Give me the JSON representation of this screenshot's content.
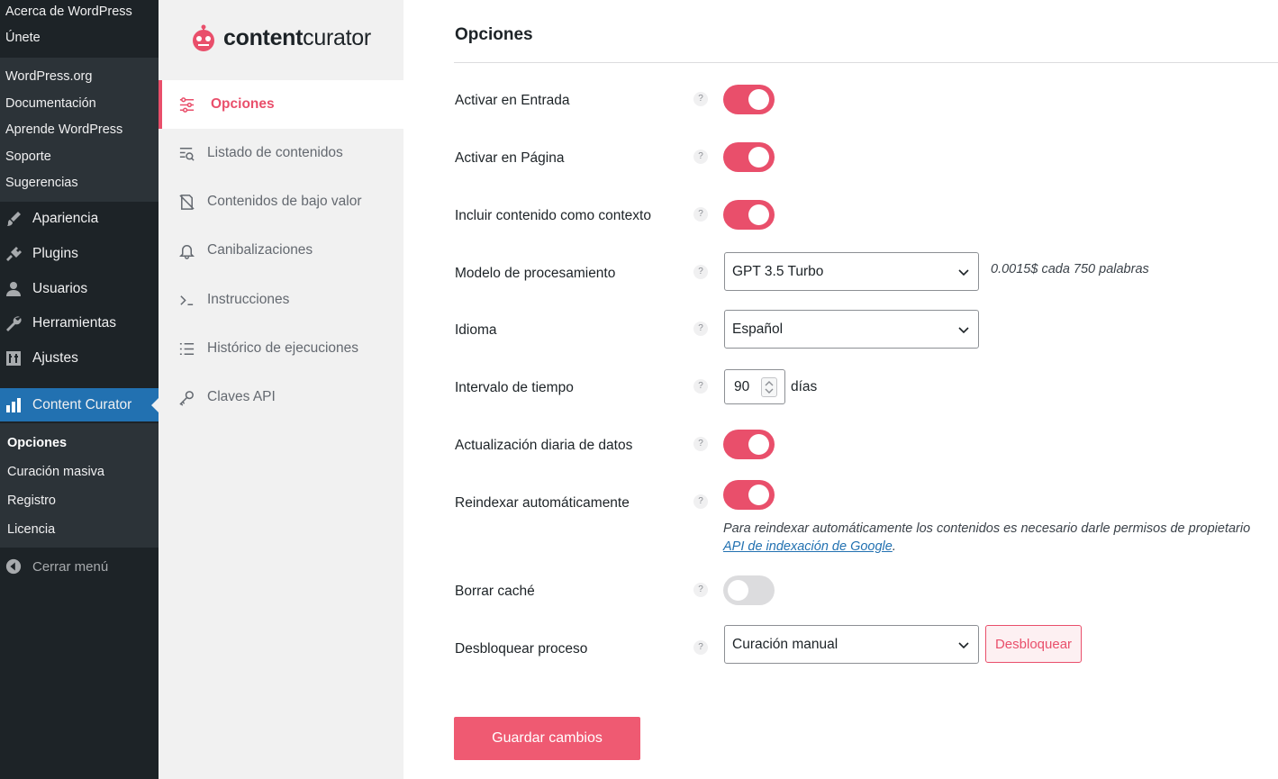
{
  "wp_menu": {
    "about_links": [
      "Acerca de WordPress",
      "Únete"
    ],
    "resource_links": [
      "WordPress.org",
      "Documentación",
      "Aprende WordPress",
      "Soporte",
      "Sugerencias"
    ],
    "items": [
      {
        "label": "Apariencia",
        "icon": "paintbrush-icon"
      },
      {
        "label": "Plugins",
        "icon": "plug-icon"
      },
      {
        "label": "Usuarios",
        "icon": "user-icon"
      },
      {
        "label": "Herramientas",
        "icon": "wrench-icon"
      },
      {
        "label": "Ajustes",
        "icon": "settings-sliders-icon"
      },
      {
        "label": "Content Curator",
        "icon": "bar-chart-icon"
      }
    ],
    "submenu": [
      "Opciones",
      "Curación masiva",
      "Registro",
      "Licencia"
    ],
    "collapse": "Cerrar menú"
  },
  "plugin": {
    "logo_bold": "content",
    "logo_rest": "curator",
    "accent": "#e94f6b",
    "nav": [
      {
        "label": "Opciones",
        "icon": "sliders-icon"
      },
      {
        "label": "Listado de contenidos",
        "icon": "list-search-icon"
      },
      {
        "label": "Contenidos de bajo valor",
        "icon": "file-off-icon"
      },
      {
        "label": "Canibalizaciones",
        "icon": "bell-icon"
      },
      {
        "label": "Instrucciones",
        "icon": "terminal-icon"
      },
      {
        "label": "Histórico de ejecuciones",
        "icon": "list-icon"
      },
      {
        "label": "Claves API",
        "icon": "key-icon"
      }
    ]
  },
  "options": {
    "title": "Opciones",
    "help": "?",
    "rows": {
      "activar_entrada": {
        "label": "Activar en Entrada",
        "on": true
      },
      "activar_pagina": {
        "label": "Activar en Página",
        "on": true
      },
      "incluir_contexto": {
        "label": "Incluir contenido como contexto",
        "on": true
      },
      "modelo": {
        "label": "Modelo de procesamiento",
        "value": "GPT 3.5 Turbo",
        "note": "0.0015$ cada 750 palabras"
      },
      "idioma": {
        "label": "Idioma",
        "value": "Español"
      },
      "intervalo": {
        "label": "Intervalo de tiempo",
        "value": "90",
        "unit": "días"
      },
      "actualizacion": {
        "label": "Actualización diaria de datos",
        "on": true
      },
      "reindexar": {
        "label": "Reindexar automáticamente",
        "on": true,
        "note": "Para reindexar automáticamente los contenidos es necesario darle permisos de propietario",
        "link": "API de indexación de Google",
        "note_end": "."
      },
      "borrar_cache": {
        "label": "Borrar caché",
        "on": false
      },
      "desbloquear": {
        "label": "Desbloquear proceso",
        "value": "Curación manual",
        "button": "Desbloquear"
      }
    },
    "save": "Guardar cambios"
  }
}
